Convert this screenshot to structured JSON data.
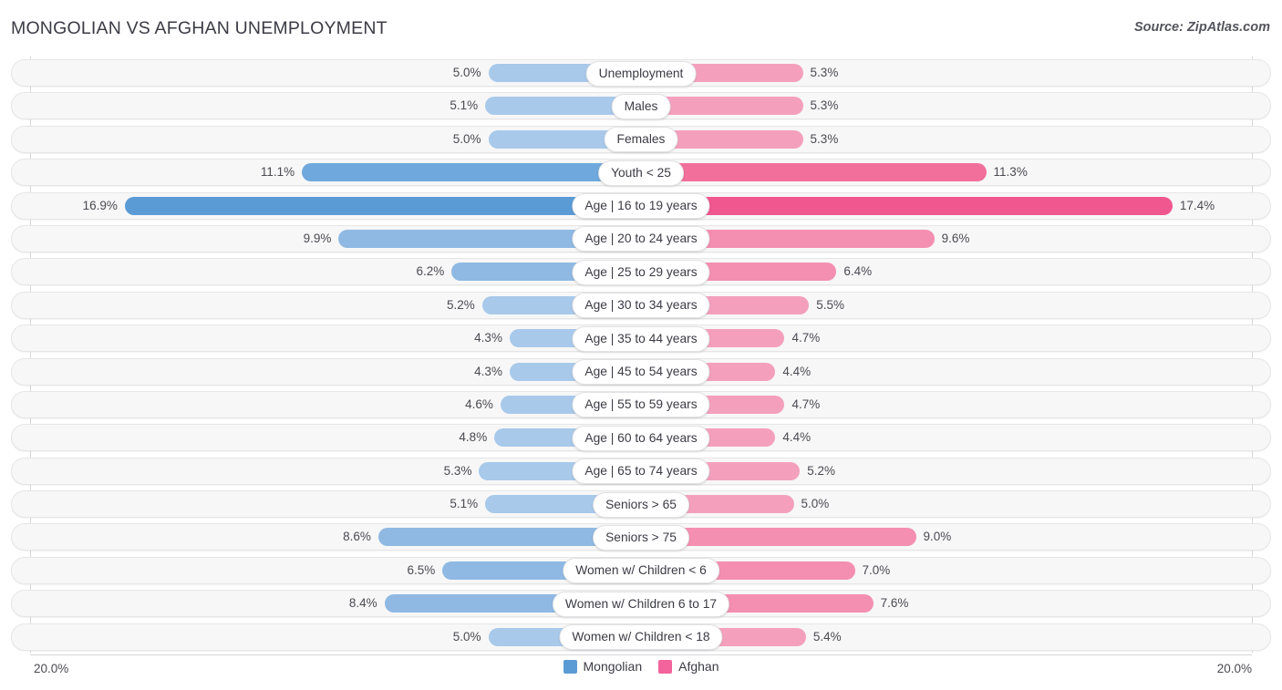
{
  "header": {
    "title": "MONGOLIAN VS AFGHAN UNEMPLOYMENT",
    "source": "Source: ZipAtlas.com"
  },
  "footer": {
    "axis_max_left": "20.0%",
    "axis_max_right": "20.0%",
    "legend": [
      {
        "label": "Mongolian",
        "color": "#5B9BD5"
      },
      {
        "label": "Afghan",
        "color": "#F2649B"
      }
    ]
  },
  "colors": {
    "left_base": "#A8C9EA",
    "left_mid": "#8FB9E3",
    "left_strong": "#6FA8DC",
    "left_max": "#5B9BD5",
    "right_base": "#F4A0BD",
    "right_mid": "#F48FB1",
    "right_strong": "#F26F9C",
    "right_max": "#F0578E",
    "track": "#F7F7F7",
    "track_border": "#E6E6E6"
  },
  "chart_data": {
    "type": "bar",
    "subtype": "diverging-butterfly",
    "title": "MONGOLIAN VS AFGHAN UNEMPLOYMENT",
    "xlabel": "",
    "ylabel": "",
    "unit": "%",
    "axis_max": 20.0,
    "xlim": [
      20.0,
      20.0
    ],
    "grid": false,
    "legend_position": "bottom-center",
    "categories": [
      "Unemployment",
      "Males",
      "Females",
      "Youth < 25",
      "Age | 16 to 19 years",
      "Age | 20 to 24 years",
      "Age | 25 to 29 years",
      "Age | 30 to 34 years",
      "Age | 35 to 44 years",
      "Age | 45 to 54 years",
      "Age | 55 to 59 years",
      "Age | 60 to 64 years",
      "Age | 65 to 74 years",
      "Seniors > 65",
      "Seniors > 75",
      "Women w/ Children < 6",
      "Women w/ Children 6 to 17",
      "Women w/ Children < 18"
    ],
    "series": [
      {
        "name": "Mongolian",
        "side": "left",
        "color": "#5B9BD5",
        "values": [
          5.0,
          5.1,
          5.0,
          11.1,
          16.9,
          9.9,
          6.2,
          5.2,
          4.3,
          4.3,
          4.6,
          4.8,
          5.3,
          5.1,
          8.6,
          6.5,
          8.4,
          5.0
        ],
        "labels": [
          "5.0%",
          "5.1%",
          "5.0%",
          "11.1%",
          "16.9%",
          "9.9%",
          "6.2%",
          "5.2%",
          "4.3%",
          "4.3%",
          "4.6%",
          "4.8%",
          "5.3%",
          "5.1%",
          "8.6%",
          "6.5%",
          "8.4%",
          "5.0%"
        ]
      },
      {
        "name": "Afghan",
        "side": "right",
        "color": "#F2649B",
        "values": [
          5.3,
          5.3,
          5.3,
          11.3,
          17.4,
          9.6,
          6.4,
          5.5,
          4.7,
          4.4,
          4.7,
          4.4,
          5.2,
          5.0,
          9.0,
          7.0,
          7.6,
          5.4
        ],
        "labels": [
          "5.3%",
          "5.3%",
          "5.3%",
          "11.3%",
          "17.4%",
          "9.6%",
          "6.4%",
          "5.5%",
          "4.7%",
          "4.4%",
          "4.7%",
          "4.4%",
          "5.2%",
          "5.0%",
          "9.0%",
          "7.0%",
          "7.6%",
          "5.4%"
        ]
      }
    ]
  }
}
